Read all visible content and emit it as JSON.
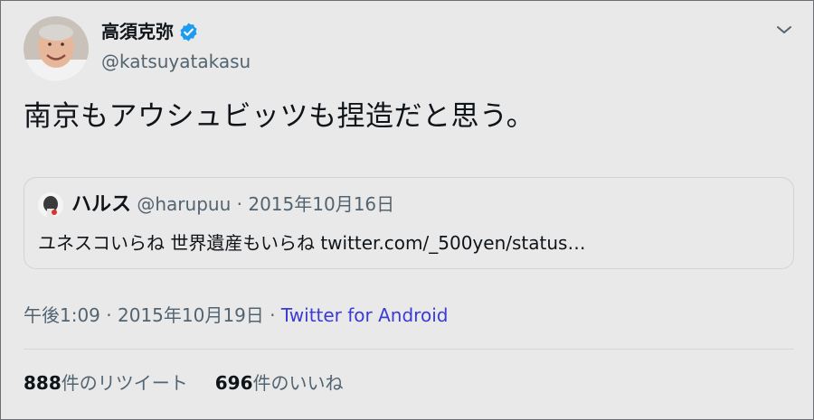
{
  "author": {
    "display_name": "高須克弥",
    "handle": "@katsuyatakasu"
  },
  "icons": {
    "verified": "verified-badge-icon",
    "menu": "chevron-down-icon"
  },
  "tweet": {
    "text": "南京もアウシュビッツも捏造だと思う。"
  },
  "quoted": {
    "display_name": "ハルス",
    "handle": "@harupuu",
    "separator": "·",
    "date": "2015年10月16日",
    "text": "ユネスコいらね 世界遺産もいらね twitter.com/_500yen/status…"
  },
  "meta": {
    "time": "午後1:09",
    "separator": "·",
    "date": "2015年10月19日",
    "separator2": "·",
    "source": "Twitter for Android"
  },
  "stats": {
    "retweets_count": "888",
    "retweets_label": "件のリツイート",
    "likes_count": "696",
    "likes_label": "件のいいね"
  },
  "colors": {
    "background": "#e9e9ea",
    "verified": "#1d9bf0",
    "link": "#3a3ad6",
    "secondary_text": "#536471"
  }
}
